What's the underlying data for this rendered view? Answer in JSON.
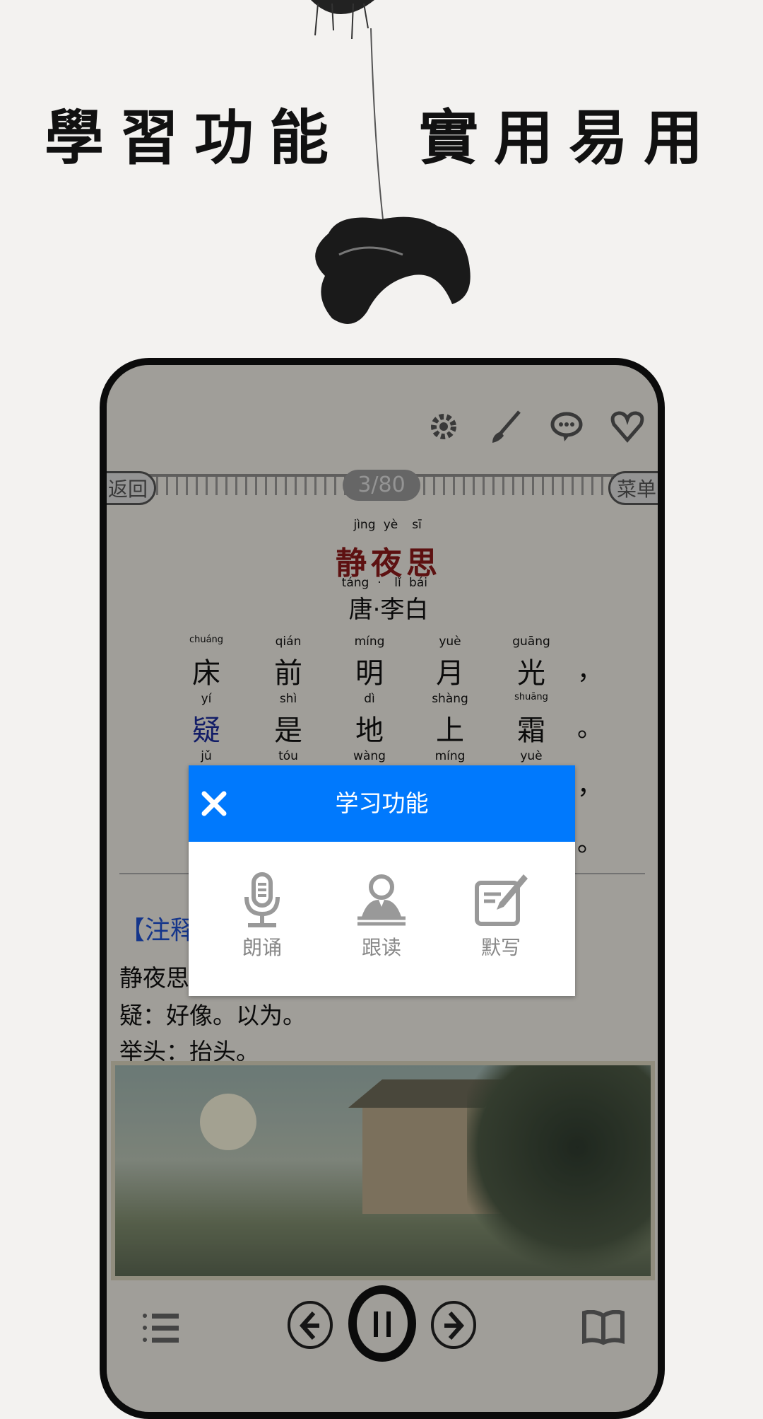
{
  "headline": "學習功能　實用易用",
  "toolbar": {
    "icons": [
      "gear-icon",
      "brush-icon",
      "comment-icon",
      "heart-icon"
    ]
  },
  "nav": {
    "back": "返回",
    "menu": "菜单",
    "page": "3/80"
  },
  "poem": {
    "title_pinyin": [
      "jìng",
      "yè",
      "sī"
    ],
    "title": "静夜思",
    "author_pinyin": [
      "táng",
      "·",
      "lǐ",
      "bái"
    ],
    "author": "唐·李白",
    "lines": [
      {
        "pinyin": [
          "chuáng",
          "qián",
          "míng",
          "yuè",
          "guāng"
        ],
        "chars": [
          "床",
          "前",
          "明",
          "月",
          "光"
        ],
        "punct": "，"
      },
      {
        "pinyin": [
          "yí",
          "shì",
          "dì",
          "shàng",
          "shuāng"
        ],
        "chars": [
          "疑",
          "是",
          "地",
          "上",
          "霜"
        ],
        "punct": "。"
      },
      {
        "pinyin": [
          "jǔ",
          "tóu",
          "wàng",
          "míng",
          "yuè"
        ],
        "chars": [],
        "punct": "，"
      },
      {
        "pinyin": [],
        "chars": [],
        "punct": "。"
      }
    ],
    "highlight_color": "#1a2a9a",
    "title_color": "#8b1a1a"
  },
  "notes": {
    "heading": "【注释】",
    "lines": [
      "静夜思",
      "疑：好像。以为。",
      "举头：抬头。"
    ]
  },
  "dialog": {
    "title": "学习功能",
    "header_color": "#0079fd",
    "items": [
      {
        "label": "朗诵",
        "icon": "microphone-icon"
      },
      {
        "label": "跟读",
        "icon": "reader-icon"
      },
      {
        "label": "默写",
        "icon": "edit-icon"
      }
    ]
  },
  "bottom_bar": {
    "icons": [
      "list-icon",
      "previous-icon",
      "pause-icon",
      "next-icon",
      "book-icon"
    ]
  }
}
